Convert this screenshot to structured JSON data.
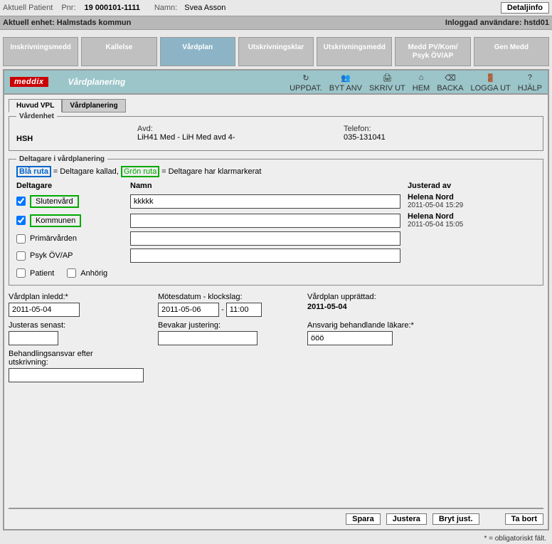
{
  "top": {
    "aktuell_patient": "Aktuell Patient",
    "pnr_lbl": "Pnr:",
    "pnr": "19 000101-1111",
    "namn_lbl": "Namn:",
    "namn": "Svea Asson",
    "detaljinfo": "Detaljinfo",
    "enhet": "Aktuell enhet: Halmstads kommun",
    "login": "Inloggad användare: hstd01"
  },
  "nav": [
    "Inskrivningsmedd",
    "Kallelse",
    "Vårdplan",
    "Utskrivningsklar",
    "Utskrivningsmedd",
    "Medd PV/Kom/\nPsyk ÖV/AP",
    "Gen Medd"
  ],
  "nav_active": 2,
  "bluebar": {
    "logo": "meddix",
    "title": "Vårdplanering",
    "tools": [
      "UPPDAT.",
      "BYT ANV",
      "SKRIV UT",
      "HEM",
      "BACKA",
      "LOGGA UT",
      "HJÄLP"
    ],
    "tool_icons": [
      "↻",
      "👥",
      "🖨",
      "⌂",
      "⌫",
      "🚪",
      "?"
    ]
  },
  "innertabs": [
    "Huvud VPL",
    "Vårdplanering"
  ],
  "innertab_active": 0,
  "ve": {
    "legend": "Vårdenhet",
    "hsh": "HSH",
    "avd_lbl": "Avd:",
    "avd": "LiH41 Med - LiH Med avd 4-",
    "tel_lbl": "Telefon:",
    "tel": "035-131041"
  },
  "delt": {
    "legend": "Deltagare i vårdplanering",
    "blue_tag": "Blå ruta",
    "blue_txt": " = Deltagare kallad,  ",
    "green_tag": "Grön ruta",
    "green_txt": " = Deltagare har klarmarkerat",
    "col_delt": "Deltagare",
    "col_namn": "Namn",
    "col_just": "Justerad av",
    "rows": [
      {
        "chk": true,
        "tag": "Slutenvård",
        "green": true,
        "namn": "kkkkk",
        "who": "Helena Nord",
        "when": "2011-05-04 15:29"
      },
      {
        "chk": true,
        "tag": "Kommunen",
        "green": true,
        "namn": "",
        "who": "Helena Nord",
        "when": "2011-05-04 15:05"
      },
      {
        "chk": false,
        "tag": "Primärvården",
        "green": false,
        "namn": "",
        "who": "",
        "when": ""
      },
      {
        "chk": false,
        "tag": "Psyk ÖV/AP",
        "green": false,
        "namn": "",
        "who": "",
        "when": ""
      }
    ],
    "patient_lbl": "Patient",
    "anhorig_lbl": "Anhörig"
  },
  "fields": {
    "inledd_lbl": "Vårdplan inledd:*",
    "inledd": "2011-05-04",
    "motes_lbl": "Mötesdatum - klockslag:",
    "motes_date": "2011-05-06",
    "motes_time": "11:00",
    "uppr_lbl": "Vårdplan upprättad:",
    "uppr": "2011-05-04",
    "just_lbl": "Justeras senast:",
    "just": "",
    "bevak_lbl": "Bevakar justering:",
    "bevak": "",
    "ansv_lbl": "Ansvarig behandlande läkare:*",
    "ansv": "ööö",
    "beh_lbl": "Behandlingsansvar efter utskrivning:",
    "beh": ""
  },
  "footer": {
    "spara": "Spara",
    "justera": "Justera",
    "bryt": "Bryt just.",
    "tabort": "Ta bort",
    "oblig": "* = obligatoriskt fält."
  }
}
